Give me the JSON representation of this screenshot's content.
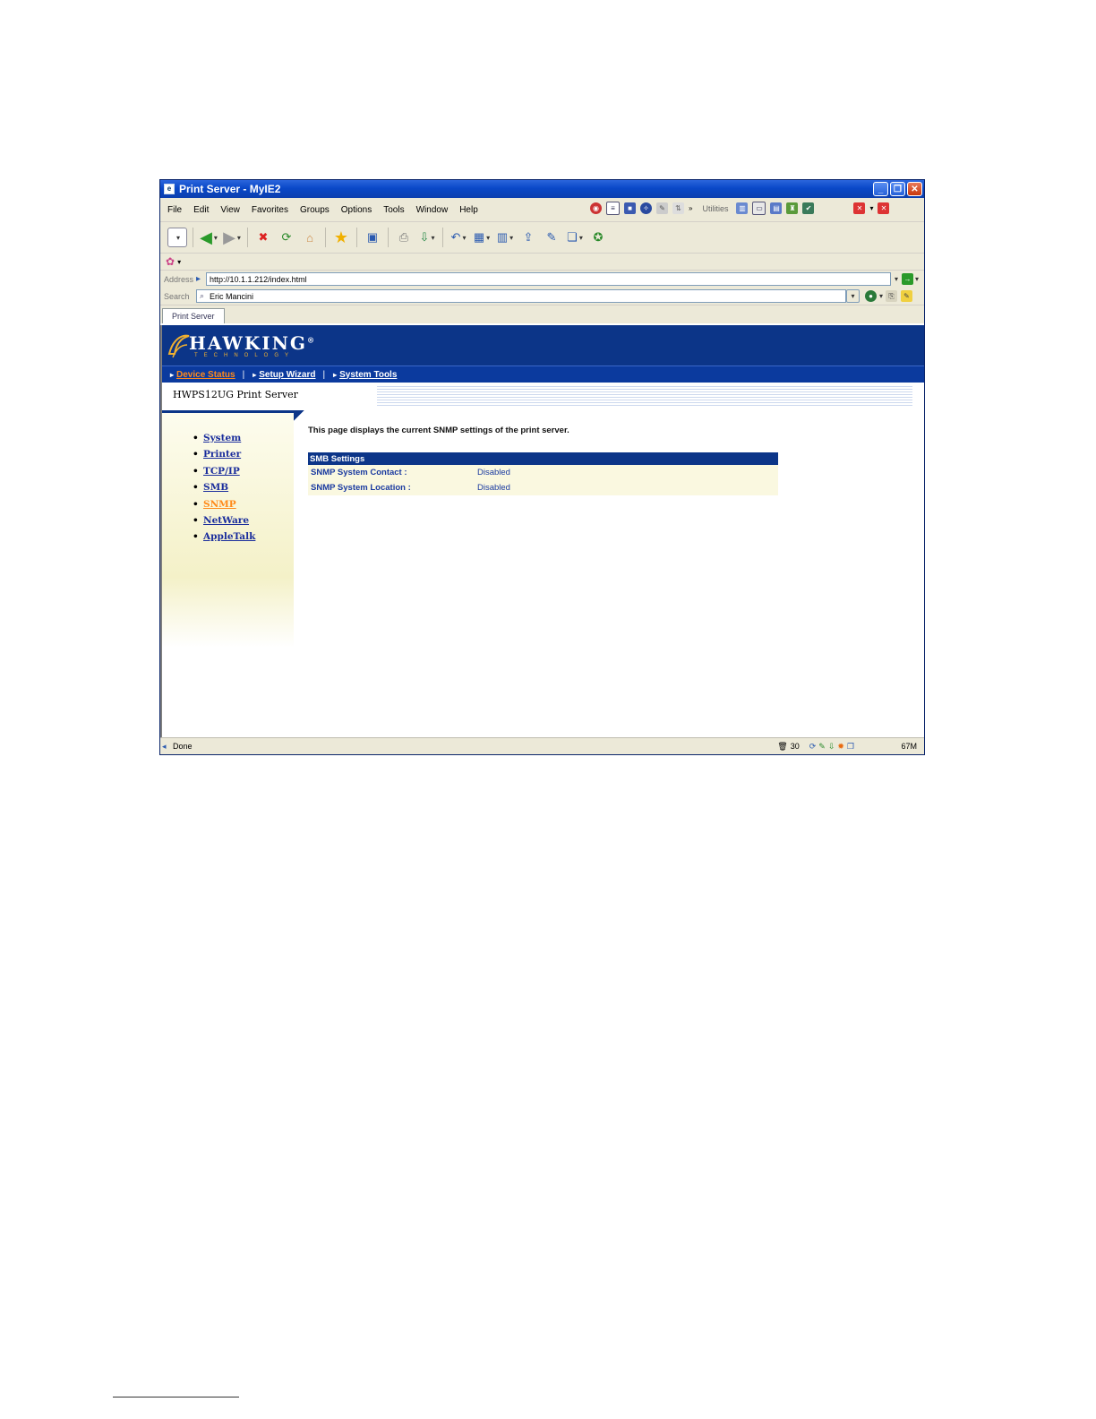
{
  "window": {
    "title": "Print Server - MyIE2"
  },
  "menu": {
    "items": [
      "File",
      "Edit",
      "View",
      "Favorites",
      "Groups",
      "Options",
      "Tools",
      "Window",
      "Help"
    ],
    "chevron": "»",
    "utilities_label": "Utilities"
  },
  "address": {
    "label": "Address",
    "value": "http://10.1.1.212/index.html"
  },
  "search": {
    "label": "Search",
    "value": "Eric Mancini"
  },
  "tab": {
    "label": "Print Server"
  },
  "brand": {
    "name": "HAWKING",
    "registered": "®",
    "tagline": "TECHNOLOGY",
    "colors": {
      "banner": "#0c3588",
      "active": "#ff8a1a",
      "link": "#1a2d9c"
    }
  },
  "topnav": {
    "items": [
      {
        "label": "Device Status",
        "active": true
      },
      {
        "label": "Setup Wizard",
        "active": false
      },
      {
        "label": "System Tools",
        "active": false
      }
    ],
    "separator": "|"
  },
  "page": {
    "title": "HWPS12UG Print Server",
    "description": "This page displays the current SNMP settings of the print server."
  },
  "sidebar": {
    "items": [
      {
        "label": "System"
      },
      {
        "label": "Printer"
      },
      {
        "label": "TCP/IP"
      },
      {
        "label": "SMB"
      },
      {
        "label": "SNMP",
        "active": true
      },
      {
        "label": "NetWare"
      },
      {
        "label": "AppleTalk"
      }
    ]
  },
  "settings": {
    "header": "SMB Settings",
    "rows": [
      {
        "key": "SNMP System Contact :",
        "value": "Disabled"
      },
      {
        "key": "SNMP System Location :",
        "value": "Disabled"
      }
    ]
  },
  "status": {
    "text": "Done",
    "count": "30",
    "memory": "67M"
  }
}
